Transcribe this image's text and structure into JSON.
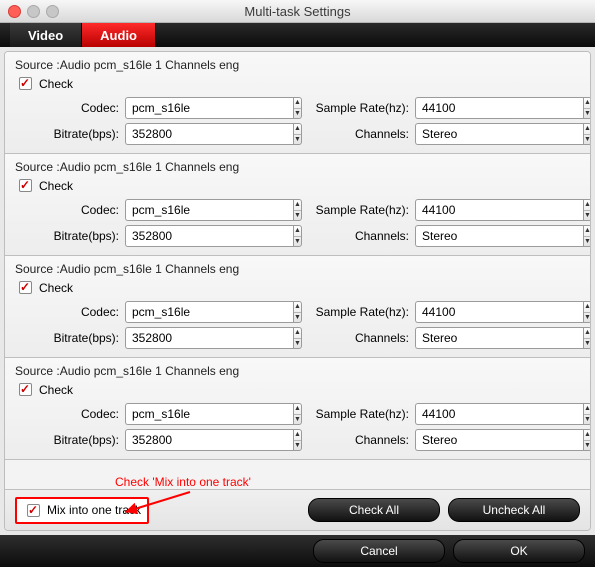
{
  "title": "Multi-task Settings",
  "tabs": {
    "video": "Video",
    "audio": "Audio"
  },
  "labels": {
    "check": "Check",
    "codec": "Codec:",
    "bitrate": "Bitrate(bps):",
    "samplerate": "Sample Rate(hz):",
    "channels": "Channels:"
  },
  "tracks": [
    {
      "source": "Source :Audio  pcm_s16le  1 Channels  eng",
      "checked": true,
      "codec": "pcm_s16le",
      "bitrate": "352800",
      "samplerate": "44100",
      "channels": "Stereo"
    },
    {
      "source": "Source :Audio  pcm_s16le  1 Channels  eng",
      "checked": true,
      "codec": "pcm_s16le",
      "bitrate": "352800",
      "samplerate": "44100",
      "channels": "Stereo"
    },
    {
      "source": "Source :Audio  pcm_s16le  1 Channels  eng",
      "checked": true,
      "codec": "pcm_s16le",
      "bitrate": "352800",
      "samplerate": "44100",
      "channels": "Stereo"
    },
    {
      "source": "Source :Audio  pcm_s16le  1 Channels  eng",
      "checked": true,
      "codec": "pcm_s16le",
      "bitrate": "352800",
      "samplerate": "44100",
      "channels": "Stereo"
    }
  ],
  "mix": {
    "checked": true,
    "label": "Mix into one track"
  },
  "annotation": "Check 'Mix into one track'",
  "buttons": {
    "checkall": "Check All",
    "uncheckall": "Uncheck All",
    "cancel": "Cancel",
    "ok": "OK"
  }
}
